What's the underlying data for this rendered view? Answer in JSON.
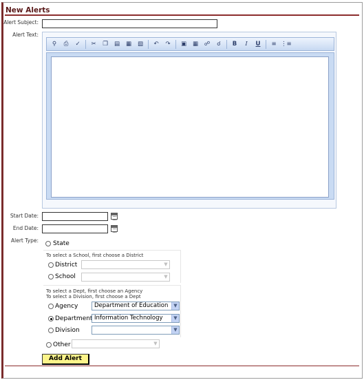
{
  "page": {
    "title": "New Alerts"
  },
  "labels": {
    "subject": "Alert Subject:",
    "text": "Alert Text:",
    "start": "Start Date:",
    "end": "End Date:",
    "type": "Alert Type:"
  },
  "inputs": {
    "subject": "",
    "start_date": "",
    "end_date": ""
  },
  "toolbar": {
    "bold": "B",
    "italic": "I",
    "underline": "U",
    "icons": [
      "find-icon",
      "print-icon",
      "spellcheck-icon",
      "cut-icon",
      "copy-icon",
      "paste-icon",
      "paste-word-icon",
      "paste-text-icon",
      "undo-icon",
      "redo-icon",
      "page-icon",
      "table-icon",
      "link-icon",
      "unlink-icon",
      "bold-icon",
      "italic-icon",
      "underline-icon",
      "ordered-list-icon",
      "bullet-list-icon"
    ]
  },
  "alert_type": {
    "state": {
      "label": "State",
      "checked": false
    },
    "school_hint": "To select a School, first choose a District",
    "district": {
      "label": "District",
      "value": ""
    },
    "school": {
      "label": "School",
      "value": ""
    },
    "dept_hint_1": "To select a Dept, first choose an Agency",
    "dept_hint_2": "To select a Division, first choose a Dept",
    "agency": {
      "label": "Agency",
      "value": "Department of Education"
    },
    "department": {
      "label": "Department",
      "value": "Information Technology",
      "checked": true
    },
    "division": {
      "label": "Division",
      "value": ""
    },
    "other": {
      "label": "Other",
      "value": ""
    }
  },
  "actions": {
    "add_alert": "Add Alert"
  }
}
